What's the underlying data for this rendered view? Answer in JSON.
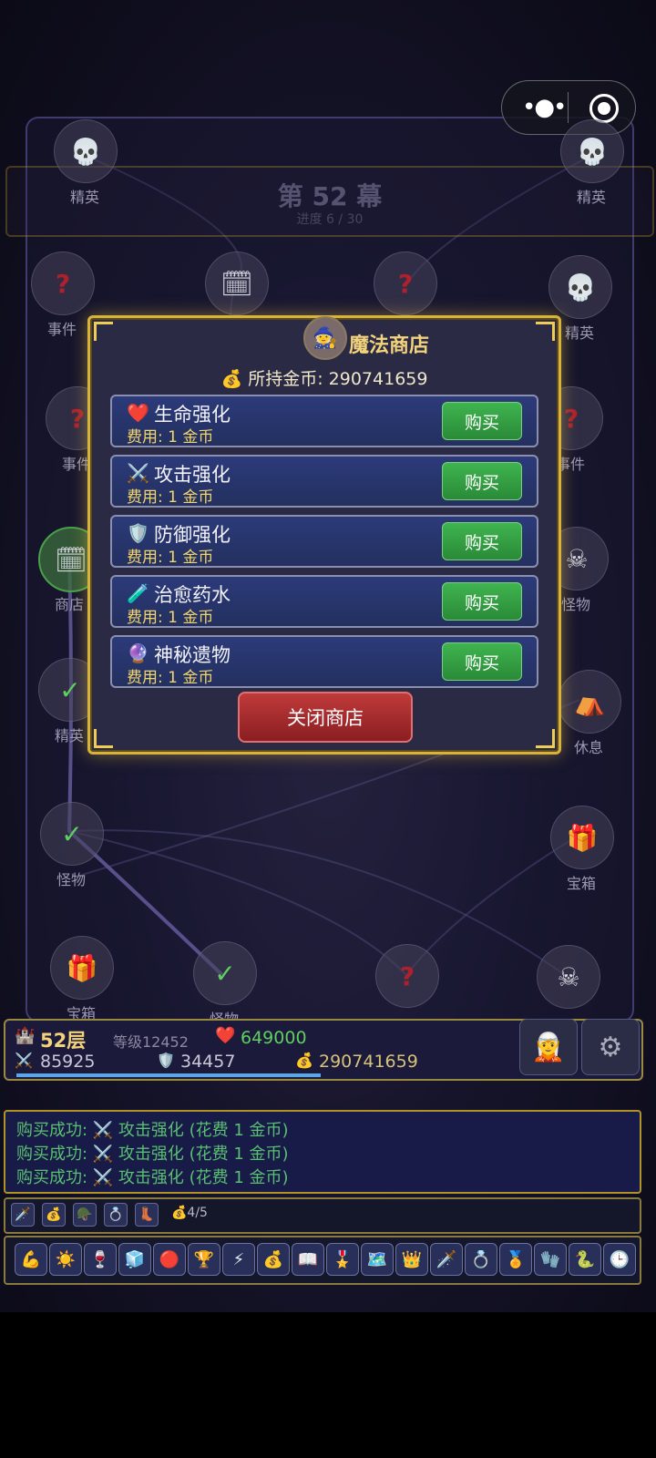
{
  "act": {
    "title": "第 52 幕",
    "progress": "进度 6 / 30"
  },
  "map_nodes": [
    {
      "label": "精英",
      "glyph": "💀",
      "kind": "elite"
    },
    {
      "label": "精英",
      "glyph": "💀",
      "kind": "elite"
    },
    {
      "label": "事件",
      "glyph": "?",
      "kind": "event"
    },
    {
      "label": "",
      "glyph": "🗓",
      "kind": "shop"
    },
    {
      "label": "",
      "glyph": "?",
      "kind": "event"
    },
    {
      "label": "精英",
      "glyph": "💀",
      "kind": "elite"
    },
    {
      "label": "事件",
      "glyph": "?",
      "kind": "event"
    },
    {
      "label": "事件",
      "glyph": "?",
      "kind": "event"
    },
    {
      "label": "商店",
      "glyph": "🗓",
      "kind": "shop"
    },
    {
      "label": "怪物",
      "glyph": "☠",
      "kind": "monster"
    },
    {
      "label": "精英",
      "glyph": "✓",
      "kind": "done"
    },
    {
      "label": "休息",
      "glyph": "⛺",
      "kind": "rest"
    },
    {
      "label": "怪物",
      "glyph": "✓",
      "kind": "done"
    },
    {
      "label": "宝箱",
      "glyph": "🎁",
      "kind": "chest"
    },
    {
      "label": "宝箱",
      "glyph": "🎁",
      "kind": "chest"
    },
    {
      "label": "怪物",
      "glyph": "✓",
      "kind": "done"
    },
    {
      "label": "",
      "glyph": "?",
      "kind": "event"
    },
    {
      "label": "",
      "glyph": "☠",
      "kind": "monster"
    }
  ],
  "shop": {
    "title": "魔法商店",
    "avatar_icon": "mage-girl-avatar",
    "gold_label": "💰 所持金币: 290741659",
    "items": [
      {
        "icon": "❤️",
        "icon_name": "heart-icon",
        "name": "生命强化",
        "cost": "费用: 1 金币",
        "buy": "购买"
      },
      {
        "icon": "⚔️",
        "icon_name": "swords-icon",
        "name": "攻击强化",
        "cost": "费用: 1 金币",
        "buy": "购买"
      },
      {
        "icon": "🛡️",
        "icon_name": "shield-icon",
        "name": "防御强化",
        "cost": "费用: 1 金币",
        "buy": "购买"
      },
      {
        "icon": "🧪",
        "icon_name": "potion-icon",
        "name": "治愈药水",
        "cost": "费用: 1 金币",
        "buy": "购买"
      },
      {
        "icon": "🔮",
        "icon_name": "orb-icon",
        "name": "神秘遗物",
        "cost": "费用: 1 金币",
        "buy": "购买"
      }
    ],
    "close": "关闭商店"
  },
  "status": {
    "floor_icon": "🏰",
    "floor": "52层",
    "level": "等级12452",
    "hp_icon": "❤️",
    "hp": "649000",
    "atk_icon": "⚔️",
    "atk": "85925",
    "def_icon": "🛡️",
    "def": "34457",
    "gold_icon": "💰",
    "gold": "290741659",
    "xp_fraction": 0.5
  },
  "log": [
    "购买成功: ⚔️ 攻击强化 (花费 1 金币)",
    "购买成功: ⚔️ 攻击强化 (花费 1 金币)",
    "购买成功: ⚔️ 攻击强化 (花费 1 金币)"
  ],
  "equipment": {
    "slots": [
      "🗡️",
      "💰",
      "🪖",
      "💍",
      "👢"
    ],
    "count": "💰4/5"
  },
  "relics": [
    "💪",
    "☀️",
    "🍷",
    "🧊",
    "🔴",
    "🏆",
    "⚡",
    "💰",
    "📖",
    "🎖️",
    "🗺️",
    "👑",
    "🗡️",
    "💍",
    "🏅",
    "🧤",
    "🐍",
    "🕒"
  ],
  "colors": {
    "accent_gold": "#d9b23a",
    "buy_green": "#3fb44f",
    "close_red": "#c03a3a",
    "log_green": "#58c070"
  }
}
